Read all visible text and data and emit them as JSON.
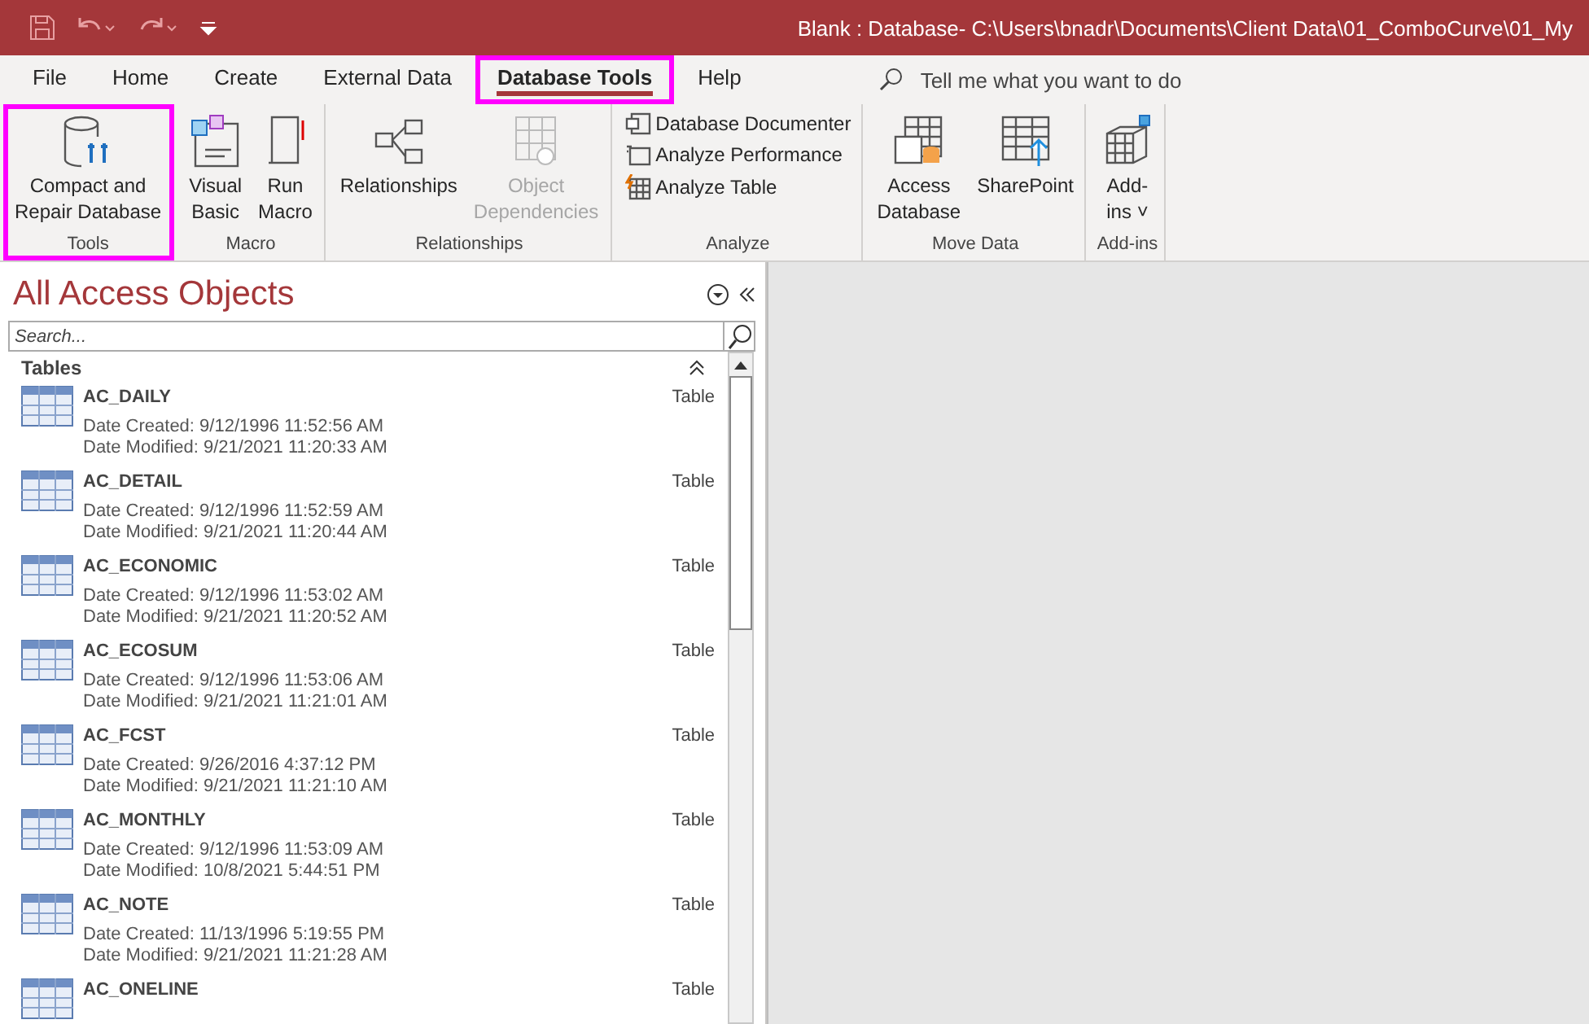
{
  "window": {
    "title": "Blank : Database- C:\\Users\\bnadr\\Documents\\Client Data\\01_ComboCurve\\01_My"
  },
  "tabs": [
    {
      "label": "File",
      "selected": false,
      "highlighted": false
    },
    {
      "label": "Home",
      "selected": false,
      "highlighted": false
    },
    {
      "label": "Create",
      "selected": false,
      "highlighted": false
    },
    {
      "label": "External Data",
      "selected": false,
      "highlighted": false
    },
    {
      "label": "Database Tools",
      "selected": true,
      "highlighted": true
    },
    {
      "label": "Help",
      "selected": false,
      "highlighted": false
    }
  ],
  "tell_me": {
    "placeholder": "Tell me what you want to do"
  },
  "ribbon": [
    {
      "label": "Tools",
      "highlighted": true,
      "commands": [
        {
          "kind": "large",
          "label": "Compact and\nRepair Database",
          "disabled": false
        }
      ]
    },
    {
      "label": "Macro",
      "highlighted": false,
      "commands": [
        {
          "kind": "large",
          "label": "Visual\nBasic",
          "disabled": false
        },
        {
          "kind": "large",
          "label": "Run\nMacro",
          "disabled": false
        }
      ]
    },
    {
      "label": "Relationships",
      "highlighted": false,
      "commands": [
        {
          "kind": "large",
          "label": "Relationships",
          "disabled": false
        },
        {
          "kind": "large",
          "label": "Object\nDependencies",
          "disabled": true
        }
      ]
    },
    {
      "label": "Analyze",
      "highlighted": false,
      "commands": [
        {
          "kind": "small",
          "label": "Database Documenter",
          "disabled": false
        },
        {
          "kind": "small",
          "label": "Analyze Performance",
          "disabled": false
        },
        {
          "kind": "small",
          "label": "Analyze Table",
          "disabled": false
        }
      ]
    },
    {
      "label": "Move Data",
      "highlighted": false,
      "commands": [
        {
          "kind": "large",
          "label": "Access\nDatabase",
          "disabled": false
        },
        {
          "kind": "large",
          "label": "SharePoint",
          "disabled": false
        }
      ]
    },
    {
      "label": "Add-ins",
      "highlighted": false,
      "commands": [
        {
          "kind": "large",
          "label": "Add-\nins ˅",
          "disabled": false
        }
      ]
    }
  ],
  "nav": {
    "title": "All Access Objects",
    "search": {
      "placeholder": "Search..."
    },
    "section": "Tables",
    "items": [
      {
        "name": "AC_DAILY",
        "type": "Table",
        "created": "Date Created: 9/12/1996 11:52:56 AM",
        "modified": "Date Modified: 9/21/2021 11:20:33 AM"
      },
      {
        "name": "AC_DETAIL",
        "type": "Table",
        "created": "Date Created: 9/12/1996 11:52:59 AM",
        "modified": "Date Modified: 9/21/2021 11:20:44 AM"
      },
      {
        "name": "AC_ECONOMIC",
        "type": "Table",
        "created": "Date Created: 9/12/1996 11:53:02 AM",
        "modified": "Date Modified: 9/21/2021 11:20:52 AM"
      },
      {
        "name": "AC_ECOSUM",
        "type": "Table",
        "created": "Date Created: 9/12/1996 11:53:06 AM",
        "modified": "Date Modified: 9/21/2021 11:21:01 AM"
      },
      {
        "name": "AC_FCST",
        "type": "Table",
        "created": "Date Created: 9/26/2016 4:37:12 PM",
        "modified": "Date Modified: 9/21/2021 11:21:10 AM"
      },
      {
        "name": "AC_MONTHLY",
        "type": "Table",
        "created": "Date Created: 9/12/1996 11:53:09 AM",
        "modified": "Date Modified: 10/8/2021 5:44:51 PM"
      },
      {
        "name": "AC_NOTE",
        "type": "Table",
        "created": "Date Created: 11/13/1996 5:19:55 PM",
        "modified": "Date Modified: 9/21/2021 11:21:28 AM"
      },
      {
        "name": "AC_ONELINE",
        "type": "Table"
      }
    ]
  }
}
